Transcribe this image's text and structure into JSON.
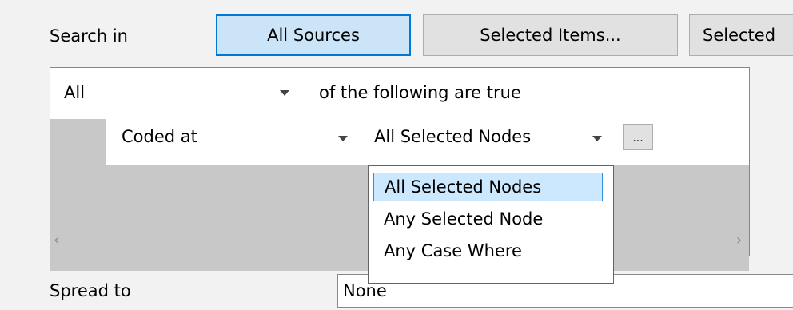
{
  "search_in": {
    "label": "Search in",
    "buttons": [
      "All Sources",
      "Selected Items...",
      "Selected"
    ]
  },
  "criteria": {
    "quantifier": "All",
    "quantifier_suffix": "of the following are true",
    "condition": {
      "field": "Coded at",
      "operator": "All Selected Nodes",
      "browse_label": "..."
    }
  },
  "dropdown": {
    "options": [
      "All Selected Nodes",
      "Any Selected Node",
      "Any Case Where"
    ],
    "selected": "All Selected Nodes"
  },
  "spread_to": {
    "label": "Spread to",
    "value": "None"
  }
}
